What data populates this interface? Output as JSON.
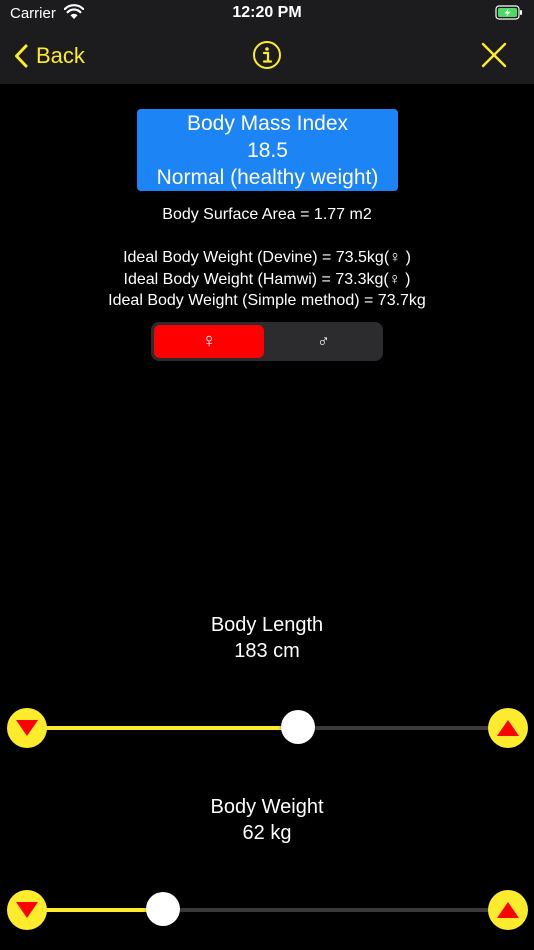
{
  "status_bar": {
    "carrier": "Carrier",
    "time": "12:20 PM"
  },
  "nav": {
    "back_label": "Back",
    "info_icon": "info-circle-icon",
    "close_icon": "close-icon"
  },
  "bmi": {
    "title": "Body Mass Index",
    "value": "18.5",
    "category": "Normal (healthy weight)"
  },
  "body_surface_area": "Body Surface Area = 1.77 m2",
  "ideal_weights": {
    "devine": "Ideal Body Weight (Devine) = 73.5kg(♀ )",
    "hamwi": "Ideal Body Weight (Hamwi) = 73.3kg(♀ )",
    "simple": "Ideal Body Weight (Simple method) = 73.7kg"
  },
  "sex_toggle": {
    "female_symbol": "♀",
    "male_symbol": "♂",
    "selected": "female"
  },
  "length_slider": {
    "label": "Body Length",
    "value": "183 cm",
    "fill_fraction": 0.57
  },
  "weight_slider": {
    "label": "Body Weight",
    "value": "62 kg",
    "fill_fraction": 0.27
  },
  "colors": {
    "accent": "#fcec2c",
    "bmi_box": "#1d84f5",
    "female_selected": "#ff0000",
    "stepper_arrow": "#ff0000",
    "background": "#000000"
  }
}
